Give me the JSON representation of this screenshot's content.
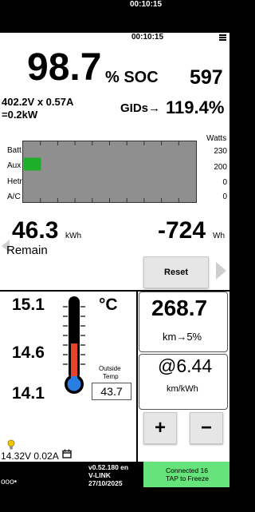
{
  "status_bar": {
    "time": "00:10:15",
    "menu_icon": "hamburger-menu-icon"
  },
  "soc": {
    "value": "98.7",
    "unit": "% SOC",
    "gids": "597"
  },
  "power": {
    "line1": "402.2V x 0.57A",
    "line2": "=0.2kW"
  },
  "gids_pct": {
    "label": "GIDs→",
    "value": "119.4%"
  },
  "bars": {
    "rows": [
      {
        "label": "Batt",
        "watts": "230"
      },
      {
        "label": "Aux",
        "watts": "200"
      },
      {
        "label": "Hetr",
        "watts": "0"
      },
      {
        "label": "A/C",
        "watts": "0"
      }
    ],
    "watts_header": "Watts",
    "aux_fill_fraction": 0.1,
    "colors": {
      "panel": "#8f8f8f",
      "aux_fill": "#1fae2a"
    }
  },
  "remain": {
    "value": "46.3",
    "unit": "kWh",
    "label": "Remain"
  },
  "net": {
    "value": "-724",
    "unit": "Wh"
  },
  "reset_button": "Reset",
  "temps": {
    "top": "15.1",
    "mid": "14.6",
    "bottom": "14.1",
    "unit": "°C",
    "outside_label_1": "Outside",
    "outside_label_2": "Temp",
    "outside_value": "43.7"
  },
  "range": {
    "value": "268.7",
    "sub": "km→5%"
  },
  "efficiency": {
    "value": "@6.44",
    "unit": "km/kWh"
  },
  "controls": {
    "plus": "+",
    "minus": "−"
  },
  "aux_battery": {
    "text": "14.32V 0.02A"
  },
  "footer": {
    "dots": "ooo•",
    "version": "v0.52.180 en",
    "device": "V-LINK",
    "date": "27/10/2025",
    "connected_line1": "Connected 16",
    "connected_line2": "TAP to Freeze",
    "connected_color": "#66e37a"
  }
}
